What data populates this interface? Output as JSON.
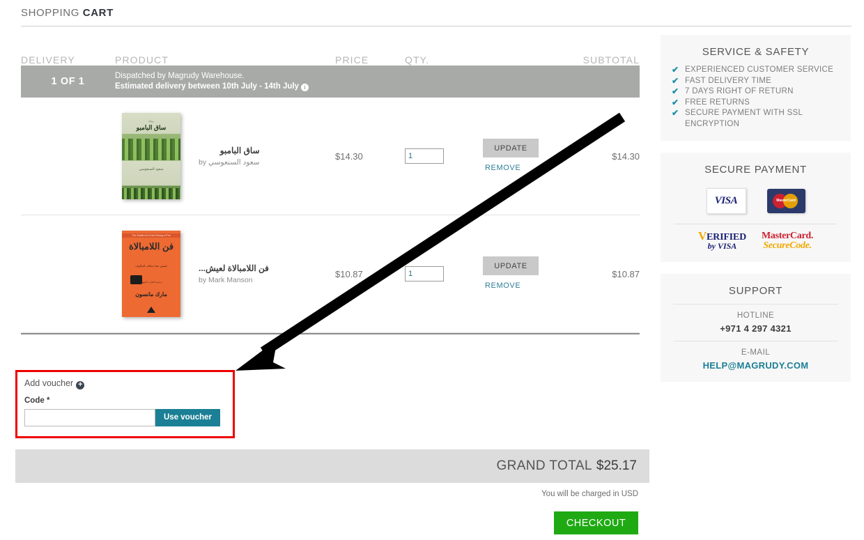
{
  "page": {
    "title_light": "SHOPPING",
    "title_bold": "CART"
  },
  "cart": {
    "columns": {
      "delivery": "DELIVERY",
      "product": "PRODUCT",
      "price": "PRICE",
      "qty": "QTY.",
      "subtotal": "SUBTOTAL"
    },
    "delivery_group": {
      "sequence": "1 OF 1",
      "dispatch_line": "Dispatched by Magrudy Warehouse.",
      "estimate_line": "Estimated delivery between 10th July - 14th July",
      "info_icon": "i"
    },
    "items": [
      {
        "name": "ساق البامبو",
        "author": "سعود السنعوسي by",
        "author_rtl": true,
        "price": "$14.30",
        "qty": "1",
        "update_label": "UPDATE",
        "remove_label": "REMOVE",
        "subtotal": "$14.30",
        "cover": {
          "style": "bamboo",
          "top_small": "رواية",
          "title": "ساق البامبو",
          "author": "سعود السنعوسي"
        }
      },
      {
        "name": "فن اللامبالاة لعيش...",
        "author": "by Mark Manson",
        "author_rtl": false,
        "price": "$10.87",
        "qty": "1",
        "update_label": "UPDATE",
        "remove_label": "REMOVE",
        "subtotal": "$10.87",
        "cover": {
          "style": "orange",
          "banner": "The Subtle Art of Not Giving a F*ck",
          "title": "فن اللامبالاة",
          "subtitle": "لعيش حياة تخالف المألوف",
          "byline": "ترجمة الحارث النبهان",
          "author": "مارك مانسون"
        }
      }
    ]
  },
  "voucher": {
    "title": "Add voucher",
    "plus_icon": "+",
    "code_label": "Code *",
    "code_value": "",
    "code_placeholder": "",
    "button_label": "Use voucher"
  },
  "totals": {
    "grand_total_label": "GRAND TOTAL",
    "grand_total_amount": "$25.17",
    "charged_note": "You will be charged in USD",
    "checkout_label": "CHECKOUT"
  },
  "sidebar": {
    "service": {
      "title": "SERVICE & SAFETY",
      "items": [
        "EXPERIENCED CUSTOMER SERVICE",
        "FAST DELIVERY TIME",
        "7 DAYS RIGHT OF RETURN",
        "FREE RETURNS",
        "SECURE PAYMENT WITH SSL ENCRYPTION"
      ],
      "check_icon": "✔"
    },
    "payment": {
      "title": "SECURE PAYMENT",
      "visa_label": "VISA",
      "mastercard_label": "MasterCard",
      "verified_v": "V",
      "verified_word": "ERIFIED",
      "verified_by": "by VISA",
      "securecode_l1": "MasterCard.",
      "securecode_l2": "SecureCode."
    },
    "support": {
      "title": "SUPPORT",
      "hotline_label": "HOTLINE",
      "hotline_value": "+971 4 297 4321",
      "email_label": "E-MAIL",
      "email_value": "HELP@MAGRUDY.COM"
    }
  },
  "annotation": {
    "arrow_color": "#000000",
    "highlight_color": "#ee0000"
  }
}
